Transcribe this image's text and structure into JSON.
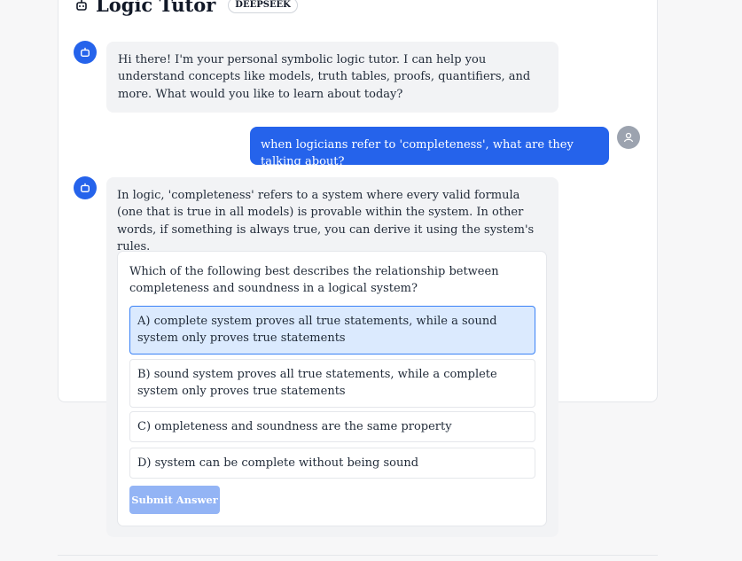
{
  "header": {
    "title": "Logic Tutor",
    "badge": "DEEPSEEK",
    "logo_icon": "robot-icon"
  },
  "colors": {
    "accent": "#2563eb",
    "bot_bubble": "#f2f3f5",
    "selected_option": "#dbeafe",
    "submit_disabled": "#93b4f5",
    "user_avatar": "#9ca3af"
  },
  "messages": [
    {
      "role": "bot",
      "text": "Hi there! I'm your personal symbolic logic tutor. I can help you understand concepts like models, truth tables, proofs, quantifiers, and more. What would you like to learn about today?"
    },
    {
      "role": "user",
      "text": "when logicians refer to 'completeness', what are they talking about?"
    },
    {
      "role": "bot",
      "text": "In logic, 'completeness' refers to a system where every valid formula (one that is true in all models) is provable within the system. In other words, if something is always true, you can derive it using the system's rules."
    }
  ],
  "quiz": {
    "question": "Which of the following best describes the relationship between completeness and soundness in a logical system?",
    "options": [
      "A) complete system proves all true statements, while a sound system only proves true statements",
      "B) sound system proves all true statements, while a complete system only proves true statements",
      "C) ompleteness and soundness are the same property",
      "D) system can be complete without being sound"
    ],
    "selected_index": 0,
    "submit_label": "Submit Answer"
  }
}
